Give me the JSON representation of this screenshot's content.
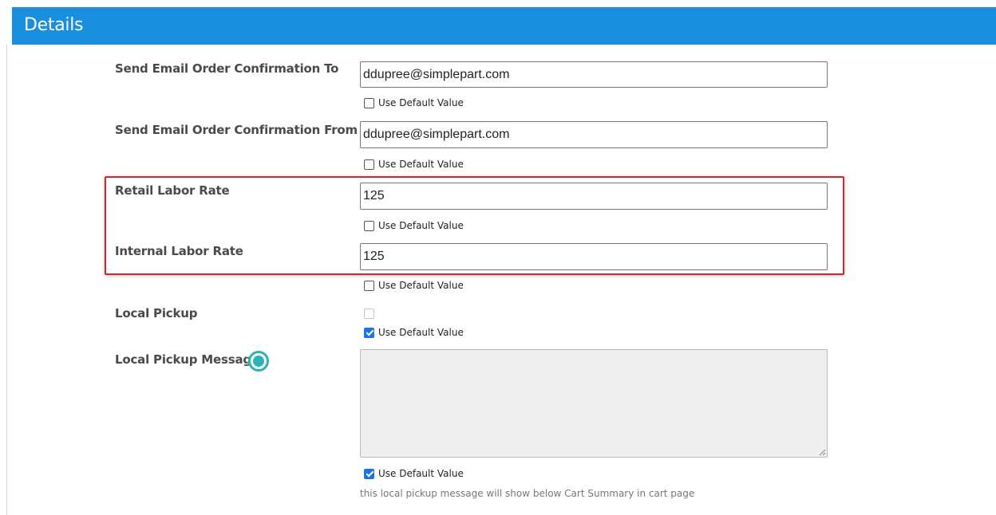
{
  "header": {
    "title": "Details",
    "color": "#1a8fe0"
  },
  "highlight_color": "#d6222a",
  "fields": {
    "email_to": {
      "label": "Send Email Order Confirmation To",
      "value": "ddupree@simplepart.com",
      "default_label": "Use Default Value",
      "default_checked": false
    },
    "email_from": {
      "label": "Send Email Order Confirmation From",
      "value": "ddupree@simplepart.com",
      "default_label": "Use Default Value",
      "default_checked": false
    },
    "retail_labor_rate": {
      "label": "Retail Labor Rate",
      "value": "125",
      "default_label": "Use Default Value",
      "default_checked": false
    },
    "internal_labor_rate": {
      "label": "Internal Labor Rate",
      "value": "125",
      "default_label": "Use Default Value",
      "default_checked": false
    },
    "local_pickup": {
      "label": "Local Pickup",
      "checked": false,
      "disabled": true,
      "default_label": "Use Default Value",
      "default_checked": true
    },
    "local_pickup_message": {
      "label": "Local Pickup Message",
      "value": "",
      "icon": "info-icon",
      "default_label": "Use Default Value",
      "default_checked": true,
      "help": "this local pickup message will show below Cart Summary in cart page"
    }
  }
}
